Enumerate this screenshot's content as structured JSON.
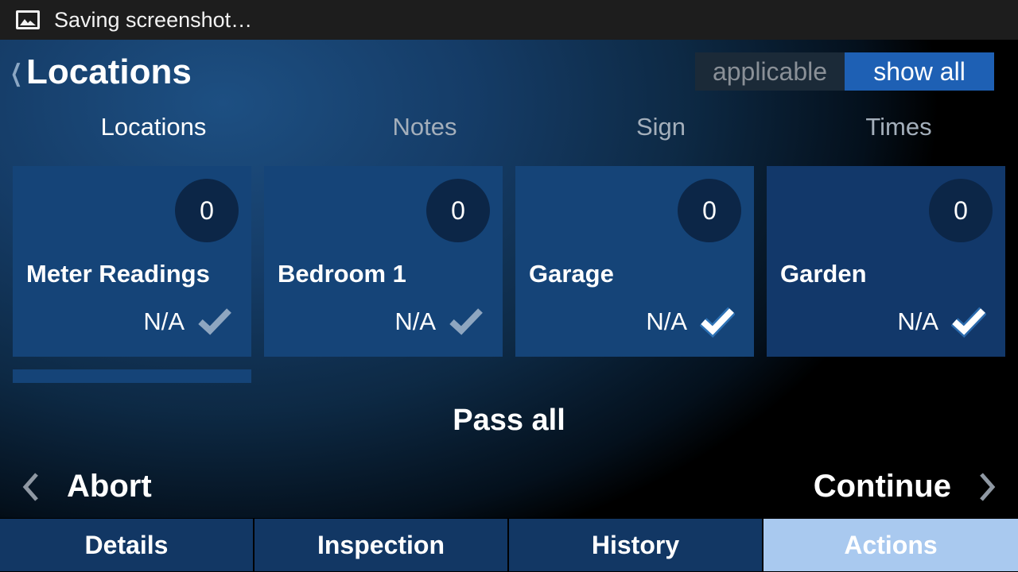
{
  "status_bar": {
    "icon": "image-icon",
    "text": "Saving screenshot…"
  },
  "header": {
    "back_icon": "back-chevron-icon",
    "title": "Locations",
    "filter_toggle": {
      "options": [
        "applicable",
        "show all"
      ],
      "selected": "show all"
    }
  },
  "subtabs": [
    {
      "label": "Locations",
      "active": true
    },
    {
      "label": "Notes",
      "active": false
    },
    {
      "label": "Sign",
      "active": false
    },
    {
      "label": "Times",
      "active": false
    }
  ],
  "cards": [
    {
      "name": "Meter Readings",
      "count": "0",
      "status": "N/A",
      "checked": false
    },
    {
      "name": "Bedroom 1",
      "count": "0",
      "status": "N/A",
      "checked": false
    },
    {
      "name": "Garage",
      "count": "0",
      "status": "N/A",
      "checked": true
    },
    {
      "name": "Garden",
      "count": "0",
      "status": "N/A",
      "checked": true
    }
  ],
  "pass_all_label": "Pass all",
  "navigation": {
    "prev_label": "Abort",
    "next_label": "Continue"
  },
  "bottom_tabs": [
    {
      "label": "Details",
      "active": false
    },
    {
      "label": "Inspection",
      "active": false
    },
    {
      "label": "History",
      "active": false
    },
    {
      "label": "Actions",
      "active": true
    }
  ],
  "colors": {
    "accent": "#1e60b4",
    "card": "#154478",
    "active_tab": "#a9c9ef",
    "check_active": "#ffffff",
    "check_inactive": "#8ea6c0"
  }
}
